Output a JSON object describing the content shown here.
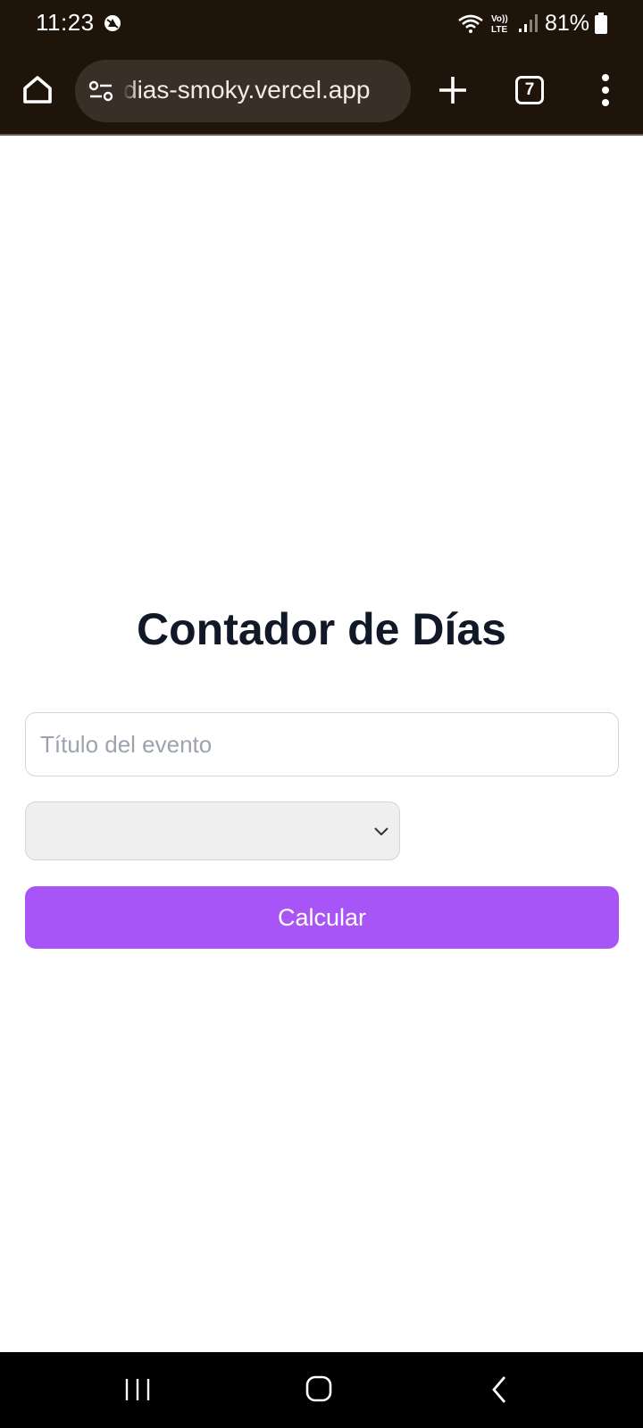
{
  "status_bar": {
    "time": "11:23",
    "battery": "81%",
    "network_label": "Vo)) LTE",
    "icons": [
      "notification-icon",
      "wifi-icon",
      "volte-icon",
      "signal-icon",
      "battery-icon"
    ]
  },
  "browser": {
    "url": "dias-smoky.vercel.app",
    "tab_count": "7",
    "icons": [
      "home-icon",
      "site-settings-icon",
      "plus-icon",
      "tabs-icon",
      "more-vert-icon"
    ]
  },
  "page": {
    "title": "Contador de Días",
    "event_input": {
      "value": "",
      "placeholder": "Título del evento"
    },
    "date_select": {
      "value": ""
    },
    "calculate_label": "Calcular",
    "colors": {
      "primary_button": "#a855f7",
      "title": "#111827",
      "placeholder": "#9ca3af"
    }
  },
  "nav_bar": {
    "icons": [
      "recents-icon",
      "home-nav-icon",
      "back-icon"
    ]
  }
}
